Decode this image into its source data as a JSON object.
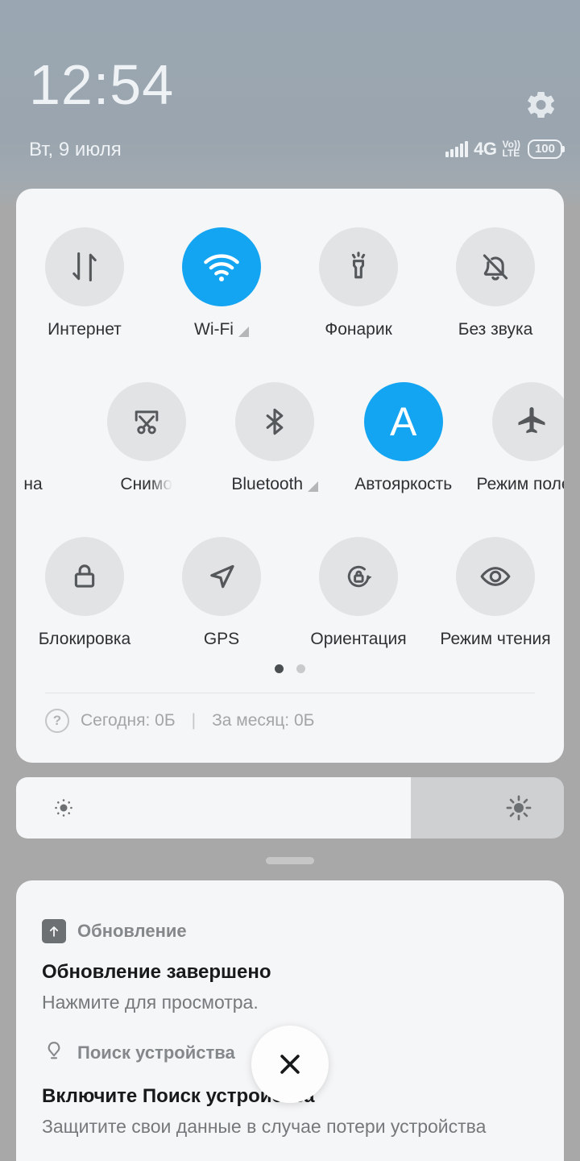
{
  "statusbar": {
    "time": "12:54",
    "date": "Вт, 9 июля",
    "network": "4G",
    "volte_top": "Vo))",
    "volte_bottom": "LTE",
    "battery": "100",
    "settings_icon": "gear-icon",
    "signal_icon": "signal-bars-icon"
  },
  "quick_settings": {
    "rows": [
      [
        {
          "label": "Интернет",
          "icon": "data-transfer-icon",
          "active": false,
          "expandable": false
        },
        {
          "label": "Wi-Fi",
          "icon": "wifi-icon",
          "active": true,
          "expandable": true
        },
        {
          "label": "Фонарик",
          "icon": "flashlight-icon",
          "active": false,
          "expandable": false
        },
        {
          "label": "Без звука",
          "icon": "bell-muted-icon",
          "active": false,
          "expandable": false
        }
      ],
      [
        {
          "label": "на",
          "icon": "partial-tile-icon",
          "active": false,
          "expandable": false
        },
        {
          "label": "Снимо",
          "icon": "screenshot-scissors-icon",
          "active": false,
          "expandable": false
        },
        {
          "label": "Bluetooth",
          "icon": "bluetooth-icon",
          "active": false,
          "expandable": true
        },
        {
          "label": "Автояркость",
          "icon": "auto-brightness-a-icon",
          "active": true,
          "expandable": false
        },
        {
          "label": "Режим полета",
          "icon": "airplane-icon",
          "active": false,
          "expandable": false
        }
      ],
      [
        {
          "label": "Блокировка",
          "icon": "lock-icon",
          "active": false,
          "expandable": false
        },
        {
          "label": "GPS",
          "icon": "navigation-arrow-icon",
          "active": false,
          "expandable": false
        },
        {
          "label": "Ориентация",
          "icon": "rotation-lock-icon",
          "active": false,
          "expandable": false
        },
        {
          "label": "Режим чтения",
          "icon": "eye-icon",
          "active": false,
          "expandable": false
        }
      ]
    ],
    "pages": {
      "count": 2,
      "active_index": 0
    },
    "data_usage": {
      "help_icon": "question-mark-icon",
      "today": "Сегодня: 0Б",
      "separator": "|",
      "month": "За месяц: 0Б"
    }
  },
  "brightness": {
    "low_icon": "brightness-low-icon",
    "high_icon": "brightness-high-icon",
    "fill_percent": 72
  },
  "drag_handle": "panel-drag-handle",
  "notifications": [
    {
      "app": "Обновление",
      "app_icon": "update-arrow-icon",
      "title": "Обновление завершено",
      "body": "Нажмите для просмотра."
    },
    {
      "app": "Поиск устройства",
      "app_icon": "find-device-pin-icon",
      "title": "Включите Поиск устройства",
      "body": "Защитите свои данные в случае потери устройства"
    }
  ],
  "clear_all": {
    "icon": "close-x-icon"
  },
  "colors": {
    "accent_blue": "#14a5f2",
    "panel_bg": "#f5f6f7",
    "tile_bg": "#e2e3e4",
    "backdrop": "#a8a8a8"
  }
}
